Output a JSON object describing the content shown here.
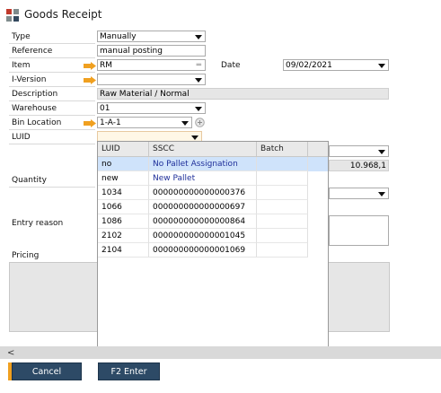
{
  "window": {
    "title": "Goods Receipt"
  },
  "form": {
    "type": {
      "label": "Type",
      "value": "Manually"
    },
    "reference": {
      "label": "Reference",
      "value": "manual posting"
    },
    "item": {
      "label": "Item",
      "value": "RM"
    },
    "date": {
      "label": "Date",
      "value": "09/02/2021"
    },
    "i_version": {
      "label": "I-Version",
      "value": ""
    },
    "description": {
      "label": "Description",
      "value": "Raw Material / Normal"
    },
    "warehouse": {
      "label": "Warehouse",
      "value": "01"
    },
    "bin_location": {
      "label": "Bin Location",
      "value": "1-A-1"
    },
    "luid": {
      "label": "LUID",
      "value": ""
    },
    "quantity": {
      "label": "Quantity",
      "value": "10.968,1"
    },
    "entry_reason": {
      "label": "Entry reason"
    },
    "pricing": {
      "label": "Pricing"
    }
  },
  "luid_grid": {
    "columns": [
      "LUID",
      "SSCC",
      "Batch"
    ],
    "rows": [
      {
        "luid": "no",
        "sscc": "No Pallet Assignation",
        "batch": ""
      },
      {
        "luid": "new",
        "sscc": "New Pallet",
        "batch": ""
      },
      {
        "luid": "1034",
        "sscc": "000000000000000376",
        "batch": ""
      },
      {
        "luid": "1066",
        "sscc": "000000000000000697",
        "batch": ""
      },
      {
        "luid": "1086",
        "sscc": "000000000000000864",
        "batch": ""
      },
      {
        "luid": "2102",
        "sscc": "000000000000001045",
        "batch": ""
      },
      {
        "luid": "2104",
        "sscc": "000000000000001069",
        "batch": ""
      }
    ]
  },
  "footer": {
    "cancel_label": "Cancel",
    "enter_label": "F2 Enter"
  },
  "colors": {
    "arrow": "#f0a020",
    "button": "#2d4a66",
    "selected_row": "#cfe3fb",
    "link_text": "#1f2f9a"
  }
}
